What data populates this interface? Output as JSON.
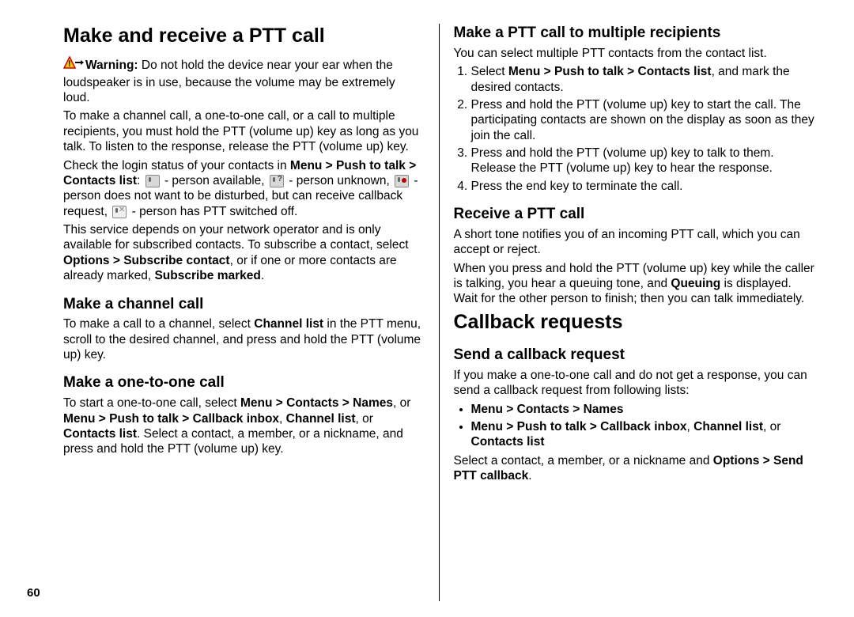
{
  "page_number": "60",
  "left": {
    "h1": "Make and receive a PTT call",
    "warn_label": "Warning:",
    "warn_text": "  Do not hold the device near your ear when the loudspeaker is in use, because the volume may be extremely loud.",
    "p2": "To make a channel call, a one-to-one call, or a call to multiple recipients, you must hold the PTT (volume up) key as long as you talk. To listen to the response, release the PTT (volume up) key.",
    "p3a": "Check the login status of your contacts in ",
    "p3_menu": "Menu  >  Push to talk  >  Contacts list",
    "p3_colon": ": ",
    "p3_avail": " - person available, ",
    "p3_unk": " - person unknown, ",
    "p3_dnd": " - person does not want to be disturbed, but can receive callback request, ",
    "p3_off": " - person has PTT switched off.",
    "p4a": "This service depends on your network operator and is only available for subscribed contacts. To subscribe a contact, select ",
    "p4_opt": "Options  >  Subscribe contact",
    "p4b": ", or if one or more contacts are already marked, ",
    "p4_sub": "Subscribe marked",
    "p4c": ".",
    "h2a": "Make a channel call",
    "p5a": "To make a call to a channel, select ",
    "p5_cl": "Channel list",
    "p5b": " in the PTT menu, scroll to the desired channel, and press and hold the PTT (volume up) key.",
    "h2b": "Make a one-to-one call",
    "p6a": "To start a one-to-one call, select ",
    "p6_m1": "Menu  >  Contacts  >  Names",
    "p6b": ", or ",
    "p6_m2": "Menu  >  Push to talk  >  Callback inbox",
    "p6c": ", ",
    "p6_m3": "Channel list",
    "p6d": ", or ",
    "p6_m4": "Contacts list",
    "p6e": ". Select a contact, a member, or a nickname, and press and hold the PTT (volume up) key."
  },
  "right": {
    "h2a": "Make a PTT call to multiple recipients",
    "p1": "You can select multiple PTT contacts from the contact list.",
    "ol1_1a": "Select ",
    "ol1_1b": "Menu  >  Push to talk  >  Contacts list",
    "ol1_1c": ", and mark the desired contacts.",
    "ol1_2": "Press and hold the PTT (volume up) key to start the call. The participating contacts are shown on the display as soon as they join the call.",
    "ol1_3": "Press and hold the PTT (volume up) key to talk to them. Release the PTT (volume up) key to hear the response.",
    "ol1_4": "Press the end key to terminate the call.",
    "h2b": "Receive a PTT call",
    "p2": "A short tone notifies you of an incoming PTT call, which you can accept or reject.",
    "p3a": "When you press and hold the PTT (volume up) key while the caller is talking, you hear a queuing tone, and ",
    "p3_q": "Queuing",
    "p3b": " is displayed. Wait for the other person to finish; then you can talk immediately.",
    "h1b": "Callback requests",
    "h2c": "Send a callback request",
    "p4": "If you make a one-to-one call and do not get a response, you can send a callback request from following lists:",
    "ul1": "Menu  >  Contacts  >  Names",
    "ul2a": "Menu  >  Push to talk  >  Callback inbox",
    "ul2b": ", ",
    "ul2c": "Channel list",
    "ul2d": ", or ",
    "ul2e": "Contacts list",
    "p5a": "Select a contact, a member, or a nickname and ",
    "p5b": "Options  >  Send PTT callback",
    "p5c": "."
  }
}
